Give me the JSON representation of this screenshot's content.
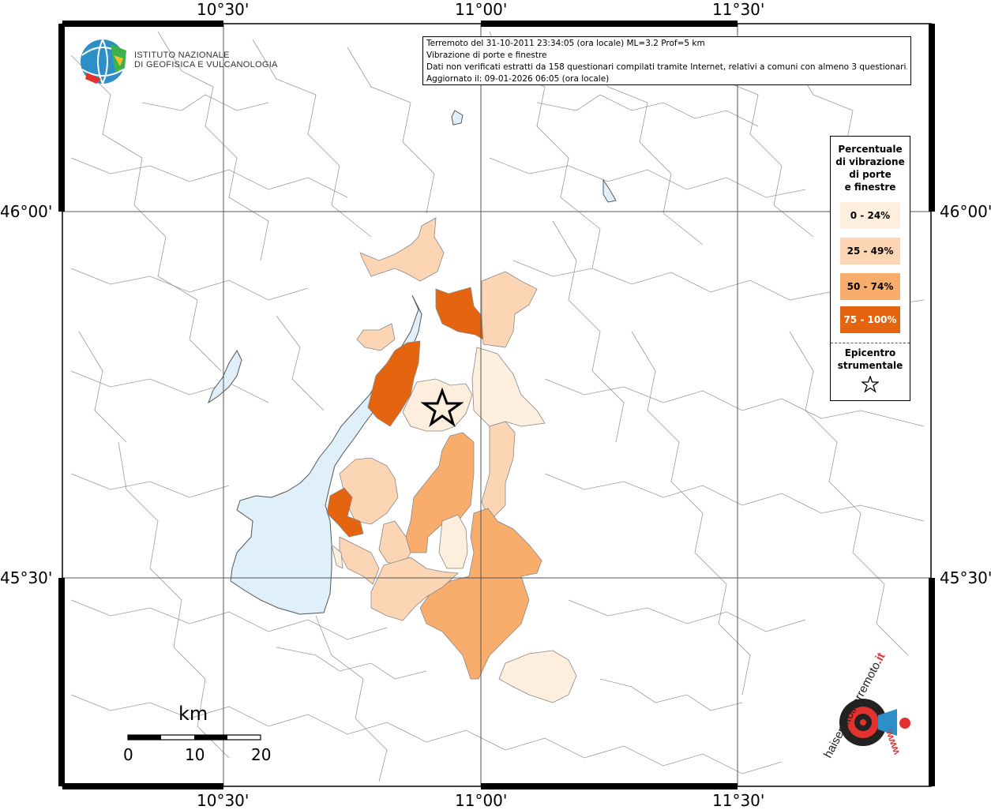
{
  "info": {
    "line1": "Terremoto del 31-10-2011 23:34:05 (ora locale) ML=3.2 Prof=5 km",
    "line2": "Vibrazione di porte e finestre",
    "line3": "Dati non verificati estratti da 158 questionari compilati tramite Internet, relativi a comuni con almeno 3 questionari.",
    "line4": "Aggiornato il: 09-01-2026 06:05 (ora locale)"
  },
  "logo": {
    "line1": "ISTITUTO NAZIONALE",
    "line2": "DI GEOFISICA E VULCANOLOGIA"
  },
  "coords": {
    "lon": [
      "10°30'",
      "11°00'",
      "11°30'"
    ],
    "lat": [
      "46°00'",
      "45°30'"
    ]
  },
  "legend": {
    "title_lines": [
      "Percentuale",
      "di vibrazione",
      "di porte",
      "e finestre"
    ],
    "classes": [
      {
        "label": "0 - 24%",
        "color": "#fdeedd"
      },
      {
        "label": "25 - 49%",
        "color": "#fcd5b4"
      },
      {
        "label": "50 - 74%",
        "color": "#f9ad6c"
      },
      {
        "label": "75 - 100%",
        "color": "#e5640f"
      }
    ],
    "epicenter_lines": [
      "Epicentro",
      "strumentale"
    ],
    "epicenter_icon": "star-icon"
  },
  "scale": {
    "unit": "km",
    "ticks": [
      "0",
      "10",
      "20"
    ]
  },
  "brand": {
    "text_black": "haisentitoilterremoto",
    "text_red": ".it",
    "text_bottom": "www."
  },
  "colors": {
    "lake": "#dff0fa",
    "border": "#888888"
  }
}
